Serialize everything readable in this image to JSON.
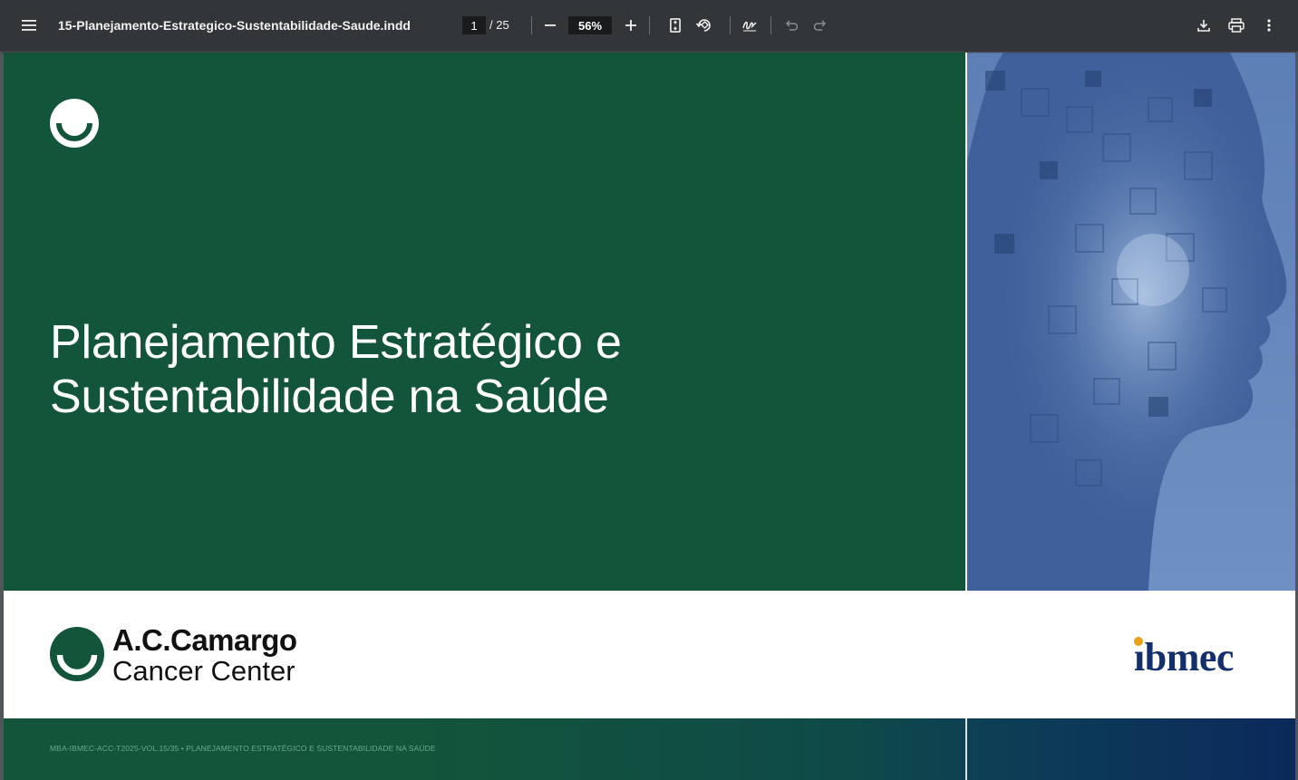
{
  "toolbar": {
    "menu_icon": "hamburger-menu-icon",
    "document_title": "15-Planejamento-Estrategico-Sustentabilidade-Saude.indd",
    "current_page": "1",
    "total_pages": "/ 25",
    "zoom_value": "56%",
    "icons": {
      "zoom_out": "minus-icon",
      "zoom_in": "plus-icon",
      "fit_page": "fit-to-page-icon",
      "rotate": "rotate-icon",
      "annotate": "draw-signature-icon",
      "undo": "undo-icon",
      "redo": "redo-icon",
      "download": "download-icon",
      "print": "print-icon",
      "more": "more-vert-icon"
    }
  },
  "document": {
    "title_line1": "Planejamento Estratégico e",
    "title_line2": "Sustentabilidade na Saúde",
    "brand_name_line1": "A.C.Camargo",
    "brand_name_line2": "Cancer Center",
    "partner_logo": "ibmec",
    "footer_text": "MBA-IBMEC-ACC-T2025-VOL.15/35 • PLANEJAMENTO ESTRATÉGICO E SUSTENTABILIDADE NA SAÚDE"
  },
  "colors": {
    "toolbar_bg": "#323639",
    "viewer_bg": "#525659",
    "brand_green": "#12553a",
    "image_blue": "#4b6fa6",
    "ibmec_navy": "#13306d",
    "ibmec_dot": "#e8a21a"
  }
}
